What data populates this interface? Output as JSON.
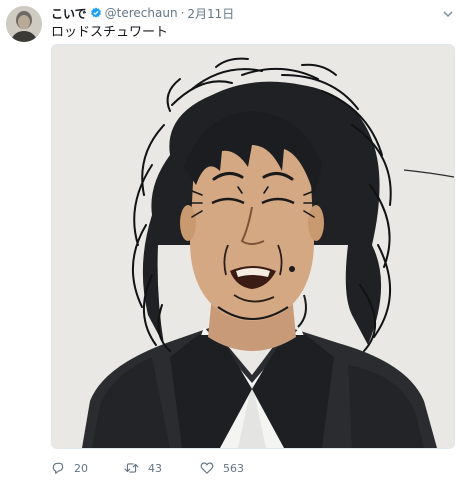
{
  "tweet": {
    "display_name": "こいで",
    "handle": "@terechaun",
    "separator": "·",
    "timestamp": "2月11日",
    "text": "ロッドスチュワート",
    "verified_icon": "verified-badge-icon",
    "media_alt": "photo"
  },
  "actions": {
    "reply_count": "20",
    "retweet_count": "43",
    "like_count": "563"
  },
  "colors": {
    "verified": "#1da1f2",
    "muted": "#657786",
    "text": "#14171a"
  }
}
